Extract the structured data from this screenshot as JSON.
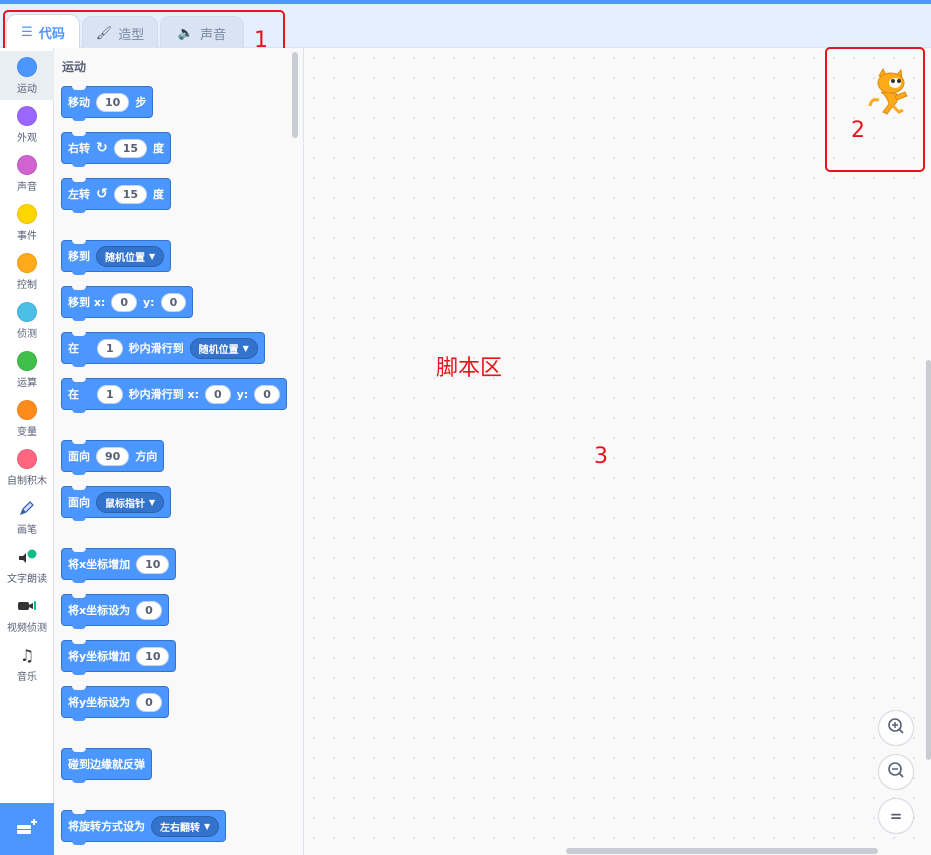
{
  "tabs": [
    {
      "label": "代码",
      "icon": "code-icon"
    },
    {
      "label": "造型",
      "icon": "brush-icon"
    },
    {
      "label": "声音",
      "icon": "speaker-icon"
    }
  ],
  "annotations": {
    "n1": "1",
    "n2": "2",
    "n3": "3",
    "script_area": "脚本区"
  },
  "categories": [
    {
      "label": "运动",
      "color": "#4c97ff"
    },
    {
      "label": "外观",
      "color": "#9966ff"
    },
    {
      "label": "声音",
      "color": "#cf63cf"
    },
    {
      "label": "事件",
      "color": "#ffd500"
    },
    {
      "label": "控制",
      "color": "#ffab19"
    },
    {
      "label": "侦测",
      "color": "#4cbfe6"
    },
    {
      "label": "运算",
      "color": "#40bf4a"
    },
    {
      "label": "变量",
      "color": "#ff8c1a"
    },
    {
      "label": "自制积木",
      "color": "#ff6680"
    },
    {
      "label": "画笔",
      "icon": "pen-icon"
    },
    {
      "label": "文字朗读",
      "icon": "text-to-speech-icon"
    },
    {
      "label": "视频侦测",
      "icon": "video-sensing-icon"
    },
    {
      "label": "音乐",
      "icon": "music-icon"
    }
  ],
  "palette": {
    "title": "运动",
    "blocks": {
      "move": {
        "a": "移动",
        "v": "10",
        "b": "步"
      },
      "turn_right": {
        "a": "右转",
        "v": "15",
        "b": "度"
      },
      "turn_left": {
        "a": "左转",
        "v": "15",
        "b": "度"
      },
      "goto": {
        "a": "移到",
        "menu": "随机位置"
      },
      "goto_xy": {
        "a": "移到 x:",
        "x": "0",
        "ylabel": "y:",
        "y": "0"
      },
      "glide_to": {
        "a": "在",
        "v": "1",
        "b": "秒内滑行到",
        "menu": "随机位置"
      },
      "glide_xy": {
        "a": "在",
        "v": "1",
        "b": "秒内滑行到 x:",
        "x": "0",
        "ylabel": "y:",
        "y": "0"
      },
      "point_dir": {
        "a": "面向",
        "v": "90",
        "b": "方向"
      },
      "point_towards": {
        "a": "面向",
        "menu": "鼠标指针"
      },
      "change_x": {
        "a": "将x坐标增加",
        "v": "10"
      },
      "set_x": {
        "a": "将x坐标设为",
        "v": "0"
      },
      "change_y": {
        "a": "将y坐标增加",
        "v": "10"
      },
      "set_y": {
        "a": "将y坐标设为",
        "v": "0"
      },
      "bounce": {
        "a": "碰到边缘就反弹"
      },
      "rotation_style": {
        "a": "将旋转方式设为",
        "menu": "左右翻转"
      }
    }
  },
  "zoom": {
    "in": "+",
    "out": "−",
    "reset": "="
  }
}
